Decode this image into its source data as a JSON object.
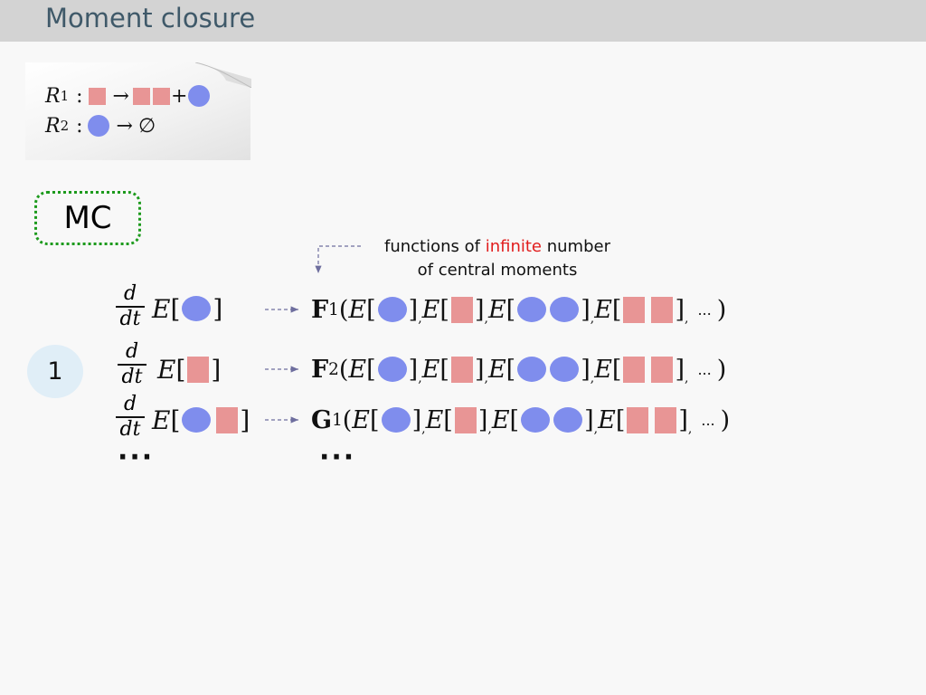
{
  "slide": {
    "title": "Moment closure"
  },
  "reactions": [
    {
      "label": "R",
      "index": "1",
      "colon": ":",
      "arrow": "→",
      "plus": "+"
    },
    {
      "label": "R",
      "index": "2",
      "colon": ":",
      "arrow": "→",
      "empty": "∅"
    }
  ],
  "method": {
    "label": "MC"
  },
  "order": {
    "label": "1"
  },
  "annotation": {
    "line1_before": "functions of ",
    "line1_highlight": "infinite",
    "line1_after": " number",
    "line2": "of central moments"
  },
  "equations": [
    {
      "func": "F",
      "func_index": "1"
    },
    {
      "func": "F",
      "func_index": "2"
    },
    {
      "func": "G",
      "func_index": "1"
    }
  ],
  "math": {
    "d": "d",
    "dt": "dt",
    "E": "E",
    "lbracket": "[",
    "rbracket": "]",
    "lparen": "(",
    "rparen": ")",
    "comma": ",",
    "ellipsis": "...",
    "continuation": "···"
  },
  "colors": {
    "title_bar": "#d3d3d3",
    "title_text": "#3f5969",
    "species_square": "#e89595",
    "species_circle": "#7f8ded",
    "mc_border": "#1d9a1d",
    "highlight": "#e11d1d",
    "arrow": "#6e6e9e",
    "badge": "#e0eef7"
  },
  "icons": {
    "species_a": "pink-square",
    "species_b": "blue-circle"
  }
}
